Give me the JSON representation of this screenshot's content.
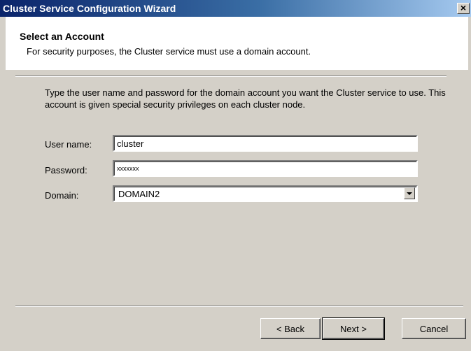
{
  "window": {
    "title": "Cluster Service Configuration Wizard",
    "close_glyph": "×"
  },
  "header": {
    "title": "Select an Account",
    "subtitle": "For security purposes, the Cluster service must use a domain account."
  },
  "instructions": "Type the user name and password for the domain account you want the Cluster service to use. This account is given special security privileges on each cluster node.",
  "form": {
    "username": {
      "label": "User name:",
      "value": "cluster"
    },
    "password": {
      "label": "Password:",
      "value": "xxxxxxx"
    },
    "domain": {
      "label": "Domain:",
      "value": "DOMAIN2"
    }
  },
  "buttons": {
    "back": "< Back",
    "next": "Next >",
    "cancel": "Cancel"
  },
  "colors": {
    "titlebar_start": "#0a246a",
    "titlebar_end": "#a6caf0",
    "dialog_face": "#d4d0c8"
  }
}
